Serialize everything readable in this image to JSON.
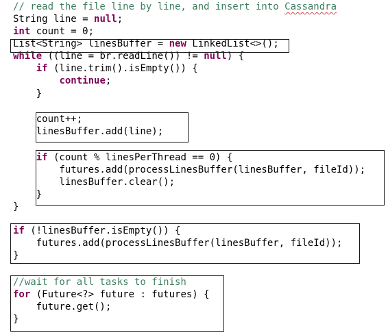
{
  "colors": {
    "comment": "#3f7f5f",
    "keyword": "#7f0055",
    "field": "#0000c0",
    "text": "#000000",
    "box_border": "#1a1a1a"
  },
  "lines": [
    {
      "id": "l1",
      "tokens": [
        {
          "t": "// read the file line by line, and insert into ",
          "k": "comment"
        },
        {
          "t": "Cassandra",
          "k": "comment",
          "sq": true
        }
      ]
    },
    {
      "id": "l2",
      "tokens": [
        {
          "t": "String ",
          "k": "text"
        },
        {
          "t": "line",
          "k": "text"
        },
        {
          "t": " = ",
          "k": "text"
        },
        {
          "t": "null",
          "k": "keyword"
        },
        {
          "t": ";",
          "k": "text"
        }
      ]
    },
    {
      "id": "l3",
      "tokens": [
        {
          "t": "int",
          "k": "keyword"
        },
        {
          "t": " count = ",
          "k": "text"
        },
        {
          "t": "0",
          "k": "text"
        },
        {
          "t": ";",
          "k": "text"
        }
      ]
    },
    {
      "id": "l4",
      "tokens": [
        {
          "t": "List<String> ",
          "k": "text"
        },
        {
          "t": "linesBuffer",
          "k": "text"
        },
        {
          "t": " = ",
          "k": "text"
        },
        {
          "t": "new",
          "k": "keyword"
        },
        {
          "t": " LinkedList<>();",
          "k": "text"
        }
      ]
    },
    {
      "id": "l5",
      "tokens": [
        {
          "t": "while",
          "k": "keyword"
        },
        {
          "t": " ((",
          "k": "text"
        },
        {
          "t": "line",
          "k": "text"
        },
        {
          "t": " = br.readLine()) != ",
          "k": "text"
        },
        {
          "t": "null",
          "k": "keyword"
        },
        {
          "t": ") {",
          "k": "text"
        }
      ]
    },
    {
      "id": "l6",
      "tokens": [
        {
          "t": "    ",
          "k": "text"
        },
        {
          "t": "if",
          "k": "keyword"
        },
        {
          "t": " (line.trim().isEmpty()) {",
          "k": "text"
        }
      ]
    },
    {
      "id": "l7",
      "tokens": [
        {
          "t": "        ",
          "k": "text"
        },
        {
          "t": "continue",
          "k": "keyword"
        },
        {
          "t": ";",
          "k": "text"
        }
      ]
    },
    {
      "id": "l8",
      "tokens": [
        {
          "t": "    }",
          "k": "text"
        }
      ]
    },
    {
      "id": "l9",
      "tokens": [
        {
          "t": "    count++;",
          "k": "text"
        }
      ]
    },
    {
      "id": "l10",
      "tokens": [
        {
          "t": "    linesBuffer.add(line);",
          "k": "text"
        }
      ]
    },
    {
      "id": "l11",
      "tokens": [
        {
          "t": "    ",
          "k": "text"
        },
        {
          "t": "if",
          "k": "keyword"
        },
        {
          "t": " (count % linesPerThread == ",
          "k": "text"
        },
        {
          "t": "0",
          "k": "text"
        },
        {
          "t": ") {",
          "k": "text"
        }
      ]
    },
    {
      "id": "l12",
      "tokens": [
        {
          "t": "        futures.add(processLinesBuffer(linesBuffer, fileId));",
          "k": "text"
        }
      ]
    },
    {
      "id": "l13",
      "tokens": [
        {
          "t": "        linesBuffer.clear();",
          "k": "text"
        }
      ]
    },
    {
      "id": "l14",
      "tokens": [
        {
          "t": "    }",
          "k": "text"
        }
      ]
    },
    {
      "id": "l15",
      "tokens": [
        {
          "t": "}",
          "k": "text"
        }
      ]
    },
    {
      "id": "l16",
      "tokens": [
        {
          "t": "if",
          "k": "keyword"
        },
        {
          "t": " (!linesBuffer.isEmpty()) {",
          "k": "text"
        }
      ]
    },
    {
      "id": "l17",
      "tokens": [
        {
          "t": "    futures.add(processLinesBuffer(linesBuffer, fileId));",
          "k": "text"
        }
      ]
    },
    {
      "id": "l18",
      "tokens": [
        {
          "t": "}",
          "k": "text"
        }
      ]
    },
    {
      "id": "l19",
      "tokens": [
        {
          "t": "//wait for all tasks to finish",
          "k": "comment"
        }
      ]
    },
    {
      "id": "l20",
      "tokens": [
        {
          "t": "for",
          "k": "keyword"
        },
        {
          "t": " (Future<?> future : futures) {",
          "k": "text"
        }
      ]
    },
    {
      "id": "l21",
      "tokens": [
        {
          "t": "    future.get();",
          "k": "text"
        }
      ]
    },
    {
      "id": "l22",
      "tokens": [
        {
          "t": "}",
          "k": "text"
        }
      ]
    }
  ]
}
